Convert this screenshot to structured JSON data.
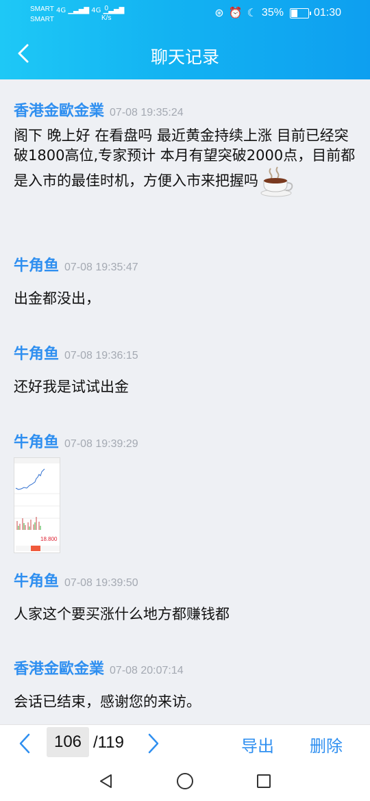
{
  "status_bar": {
    "carrier1": "SMART",
    "carrier2": "SMART",
    "sig1": "4G",
    "sig2": "4G",
    "speed_value": "0",
    "speed_unit": "K/s",
    "battery": "35%",
    "time": "01:30"
  },
  "header": {
    "title": "聊天记录"
  },
  "messages": [
    {
      "sender": "香港金歐金業",
      "time": "07-08 19:35:24",
      "text": "阁下  晚上好 在看盘吗 最近黄金持续上涨 目前已经突破1800高位,专家预计 本月有望突破2000点，目前都是入市的最佳时机，方便入市来把握吗"
    },
    {
      "sender": "牛角鱼",
      "time": "07-08 19:35:47",
      "text": "出金都没出，"
    },
    {
      "sender": "牛角鱼",
      "time": "07-08 19:36:15",
      "text": "还好我是试试出金"
    },
    {
      "sender": "牛角鱼",
      "time": "07-08 19:39:29",
      "image_price": "18.800"
    },
    {
      "sender": "牛角鱼",
      "time": "07-08 19:39:50",
      "text": "人家这个要买涨什么地方都赚钱都"
    },
    {
      "sender": "香港金歐金業",
      "time": "07-08 20:07:14",
      "text": "会话已结束，感谢您的来访。"
    }
  ],
  "pager": {
    "current_page": "106",
    "total_pages": "/119",
    "export_label": "导出",
    "delete_label": "删除"
  },
  "colors": {
    "accent": "#2f8ff0",
    "header_start": "#1ec8f6",
    "header_end": "#0e9ff0",
    "timestamp": "#a4a9b2",
    "chat_bg": "#eef0f4"
  }
}
